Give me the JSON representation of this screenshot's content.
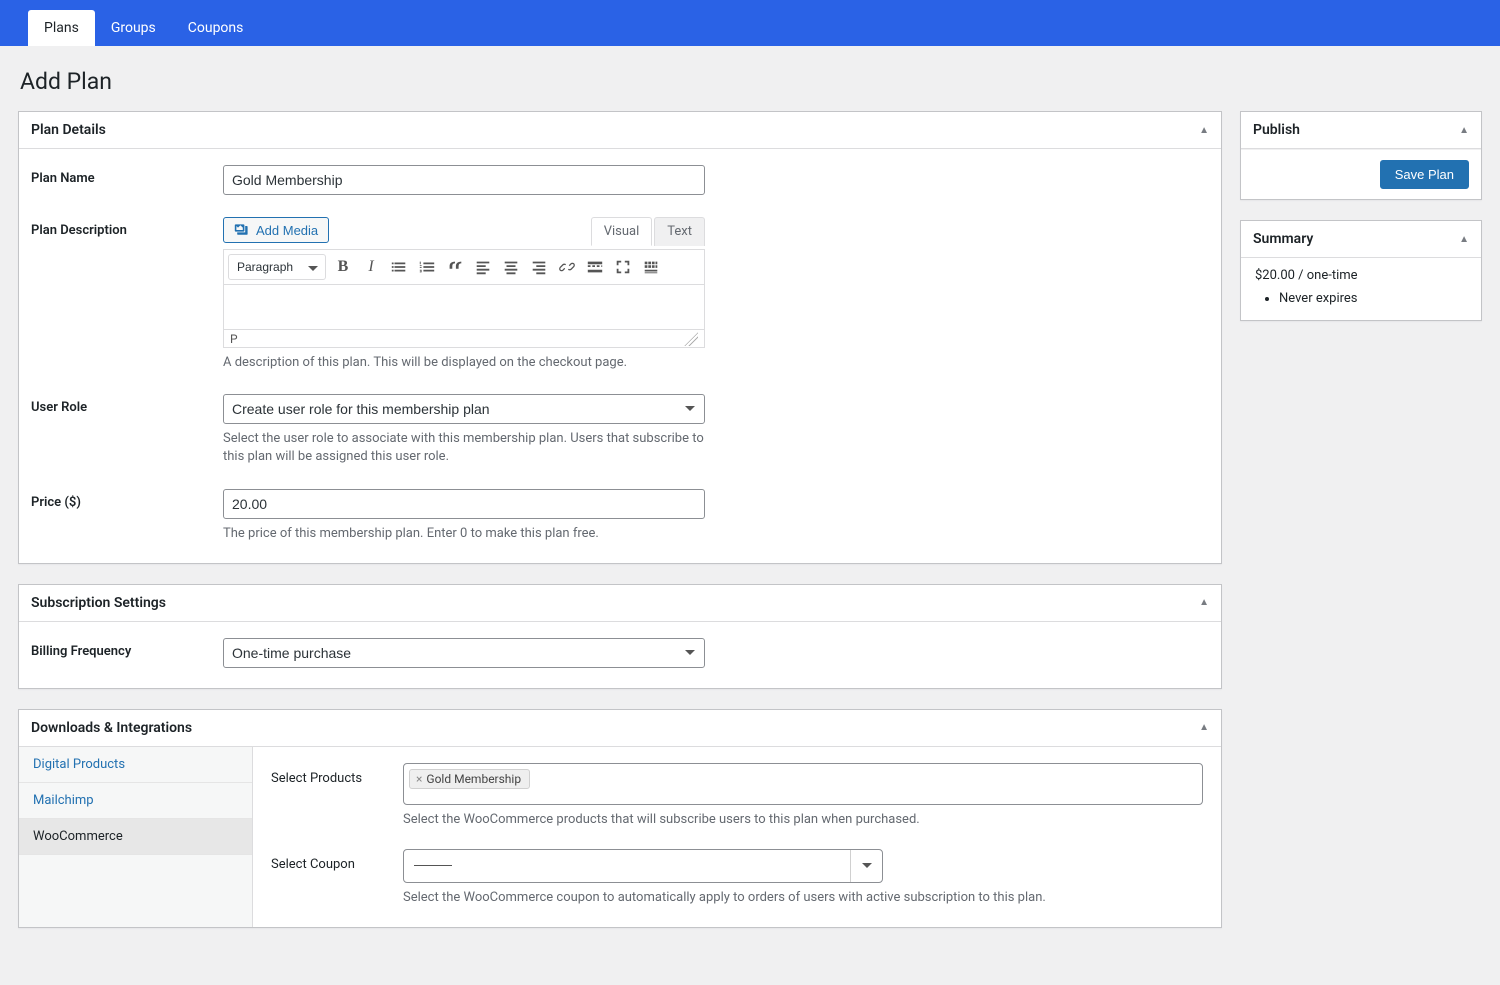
{
  "topTabs": {
    "plans": "Plans",
    "groups": "Groups",
    "coupons": "Coupons"
  },
  "pageTitle": "Add Plan",
  "planDetails": {
    "header": "Plan Details",
    "planNameLabel": "Plan Name",
    "planNameValue": "Gold Membership",
    "planDescLabel": "Plan Description",
    "addMediaLabel": "Add Media",
    "editorVisual": "Visual",
    "editorText": "Text",
    "blockFormat": "Paragraph",
    "pathIndicator": "P",
    "planDescHelp": "A description of this plan. This will be displayed on the checkout page.",
    "userRoleLabel": "User Role",
    "userRoleValue": "Create user role for this membership plan",
    "userRoleHelp": "Select the user role to associate with this membership plan. Users that subscribe to this plan will be assigned this user role.",
    "priceLabel": "Price ($)",
    "priceValue": "20.00",
    "priceHelp": "The price of this membership plan. Enter 0 to make this plan free."
  },
  "subscription": {
    "header": "Subscription Settings",
    "billingLabel": "Billing Frequency",
    "billingValue": "One-time purchase"
  },
  "integrations": {
    "header": "Downloads & Integrations",
    "tabs": {
      "digital": "Digital Products",
      "mailchimp": "Mailchimp",
      "woo": "WooCommerce"
    },
    "productsLabel": "Select Products",
    "productTag": "Gold Membership",
    "productsHelp": "Select the WooCommerce products that will subscribe users to this plan when purchased.",
    "couponLabel": "Select Coupon",
    "couponHelp": "Select the WooCommerce coupon to automatically apply to orders of users with active subscription to this plan."
  },
  "publish": {
    "header": "Publish",
    "saveLabel": "Save Plan"
  },
  "summary": {
    "header": "Summary",
    "priceLine": "$20.00 / one-time",
    "expiry": "Never expires"
  }
}
